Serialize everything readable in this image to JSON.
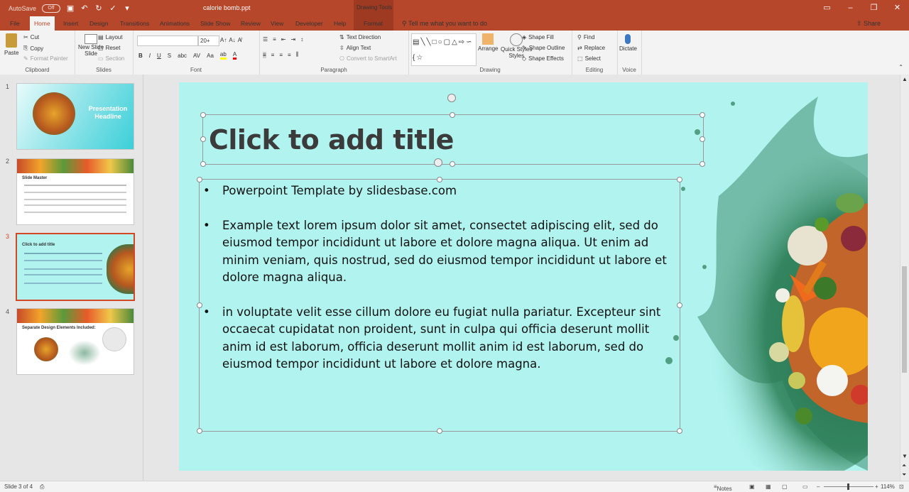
{
  "titlebar": {
    "autosave_label": "AutoSave",
    "autosave_state": "Off",
    "document_title": "calorie bomb.ppt",
    "contextual_tab_group": "Drawing Tools"
  },
  "tabs": [
    "File",
    "Home",
    "Insert",
    "Design",
    "Transitions",
    "Animations",
    "Slide Show",
    "Review",
    "View",
    "Developer",
    "Help",
    "Format"
  ],
  "active_tab": "Home",
  "tell_me": "Tell me what you want to do",
  "share_label": "Share",
  "ribbon": {
    "clipboard": {
      "label": "Clipboard",
      "paste": "Paste",
      "cut": "Cut",
      "copy": "Copy",
      "format_painter": "Format Painter"
    },
    "slides": {
      "label": "Slides",
      "new_slide": "New Slide",
      "new_slide_2": "Slide",
      "layout": "Layout",
      "reset": "Reset",
      "section": "Section"
    },
    "font": {
      "label": "Font",
      "font_name": "",
      "font_size": "20+"
    },
    "paragraph": {
      "label": "Paragraph",
      "text_direction": "Text Direction",
      "align_text": "Align Text",
      "convert_smartart": "Convert to SmartArt"
    },
    "drawing": {
      "label": "Drawing",
      "arrange": "Arrange",
      "quick_styles": "Quick Styles",
      "quick_styles_2": "Styles",
      "shape_fill": "Shape Fill",
      "shape_outline": "Shape Outline",
      "shape_effects": "Shape Effects"
    },
    "editing": {
      "label": "Editing",
      "find": "Find",
      "replace": "Replace",
      "select": "Select"
    },
    "voice": {
      "label": "Voice",
      "dictate": "Dictate"
    }
  },
  "thumbnails": [
    {
      "num": "1",
      "title": "Presentation Headline"
    },
    {
      "num": "2",
      "title": "Slide Master"
    },
    {
      "num": "3",
      "title": "Click to add title"
    },
    {
      "num": "4",
      "title": "Separate Design Elements Included:"
    }
  ],
  "slide": {
    "title": "Click to add title",
    "bullets": [
      "Powerpoint Template by slidesbase.com",
      "Example text lorem ipsum dolor sit amet, consectet adipiscing elit, sed do eiusmod tempor incididunt ut labore et dolore magna aliqua. Ut enim ad minim veniam, quis nostrud, sed do eiusmod tempor incididunt ut labore et dolore magna aliqua.",
      "in voluptate velit esse cillum dolore eu fugiat nulla pariatur. Excepteur sint occaecat cupidatat non proident, sunt in culpa qui officia deserunt mollit anim id est laborum, officia deserunt mollit anim id est laborum, sed do eiusmod tempor incididunt ut labore et dolore magna."
    ]
  },
  "status": {
    "slide_counter": "Slide 3 of 4",
    "notes": "Notes",
    "zoom": "114%"
  },
  "colors": {
    "accent": "#b7472a",
    "slide_bg": "#b0f3ef",
    "selected_thumb": "#d24726"
  }
}
